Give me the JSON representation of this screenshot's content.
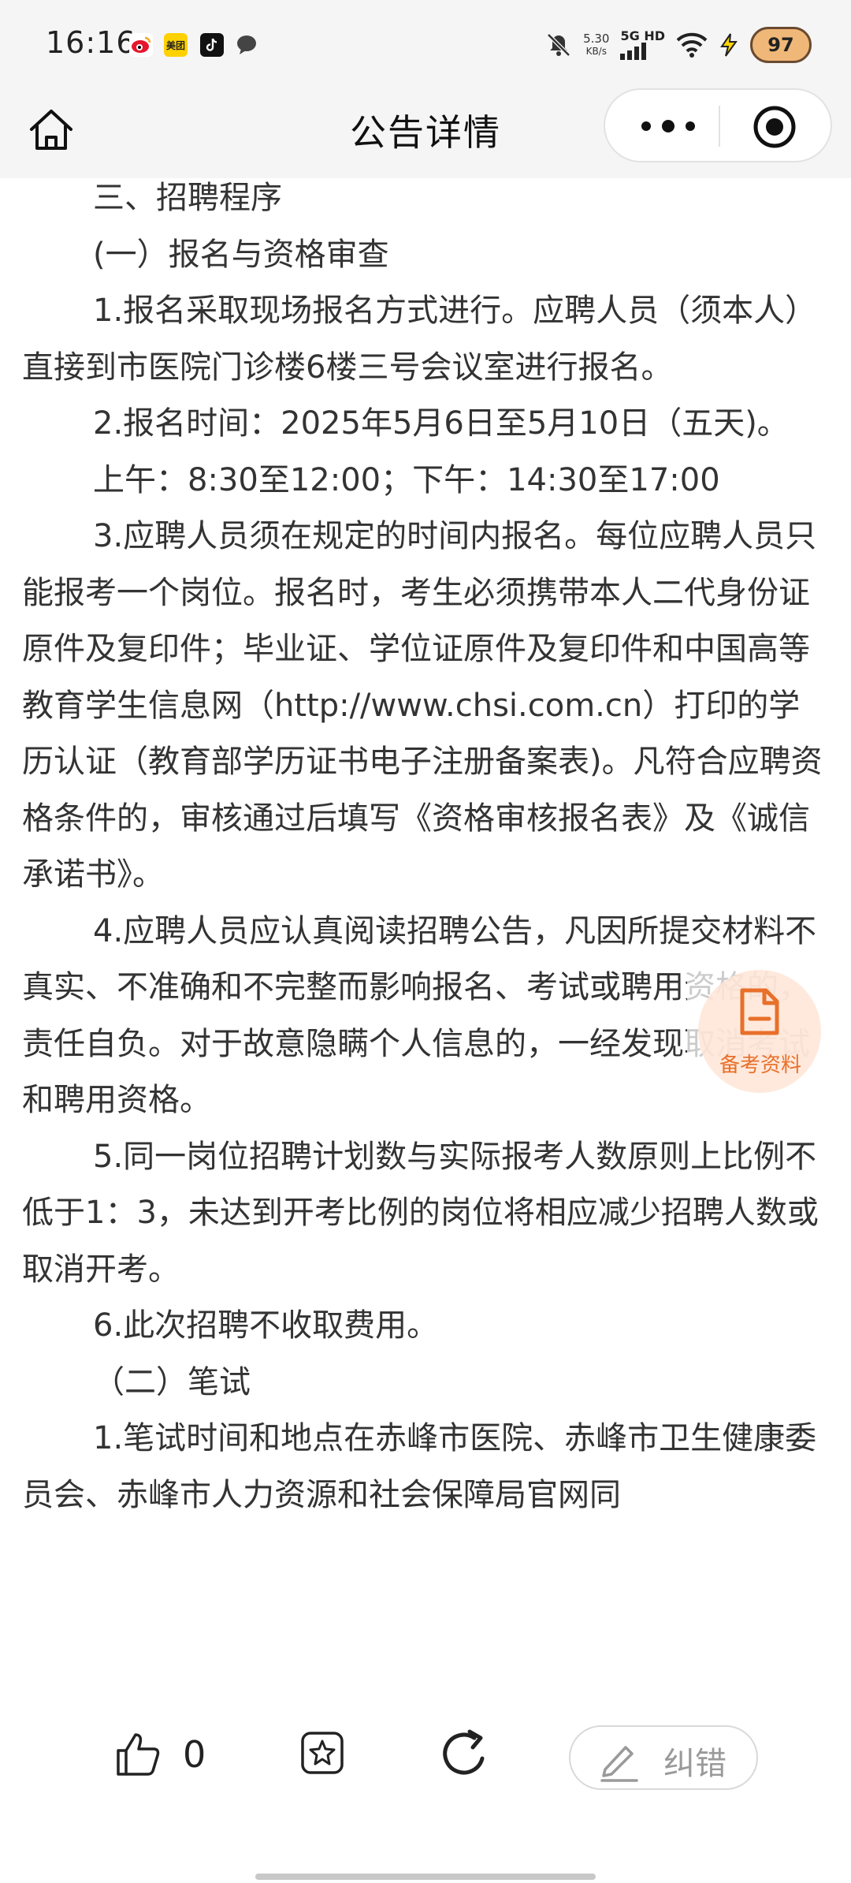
{
  "status_bar": {
    "time": "16:16",
    "speed_value": "5.30",
    "speed_unit": "KB/s",
    "network": "5G HD",
    "battery": "97",
    "icons": [
      "weibo-icon",
      "meituan-icon",
      "tiktok-icon",
      "message-icon",
      "mute-icon",
      "signal-icon",
      "wifi-icon",
      "flash-icon"
    ]
  },
  "nav": {
    "title": "公告详情"
  },
  "content": {
    "paragraphs": [
      "三、招聘程序",
      "(一）报名与资格审查",
      "1.报名采取现场报名方式进行。应聘人员（须本人）直接到市医院门诊楼6楼三号会议室进行报名。",
      "2.报名时间：2025年5月6日至5月10日（五天)。",
      "上午：8:30至12:00；下午：14:30至17:00",
      "3.应聘人员须在规定的时间内报名。每位应聘人员只能报考一个岗位。报名时，考生必须携带本人二代身份证原件及复印件；毕业证、学位证原件及复印件和中国高等教育学生信息网（http://www.chsi.com.cn）打印的学历认证（教育部学历证书电子注册备案表)。凡符合应聘资格条件的，审核通过后填写《资格审核报名表》及《诚信承诺书》。",
      "4.应聘人员应认真阅读招聘公告，凡因所提交材料不真实、不准确和不完整而影响报名、考试或聘用资格的，责任自负。对于故意隐瞒个人信息的，一经发现取消考试和聘用资格。",
      "5.同一岗位招聘计划数与实际报考人数原则上比例不低于1：3，未达到开考比例的岗位将相应减少招聘人数或取消开考。",
      "6.此次招聘不收取费用。",
      "（二）笔试",
      "1.笔试时间和地点在赤峰市医院、赤峰市卫生健康委员会、赤峰市人力资源和社会保障局官网同"
    ]
  },
  "float_button": {
    "label": "备考资料"
  },
  "bottom_bar": {
    "like_count": "0",
    "correct_label": "纠错"
  }
}
